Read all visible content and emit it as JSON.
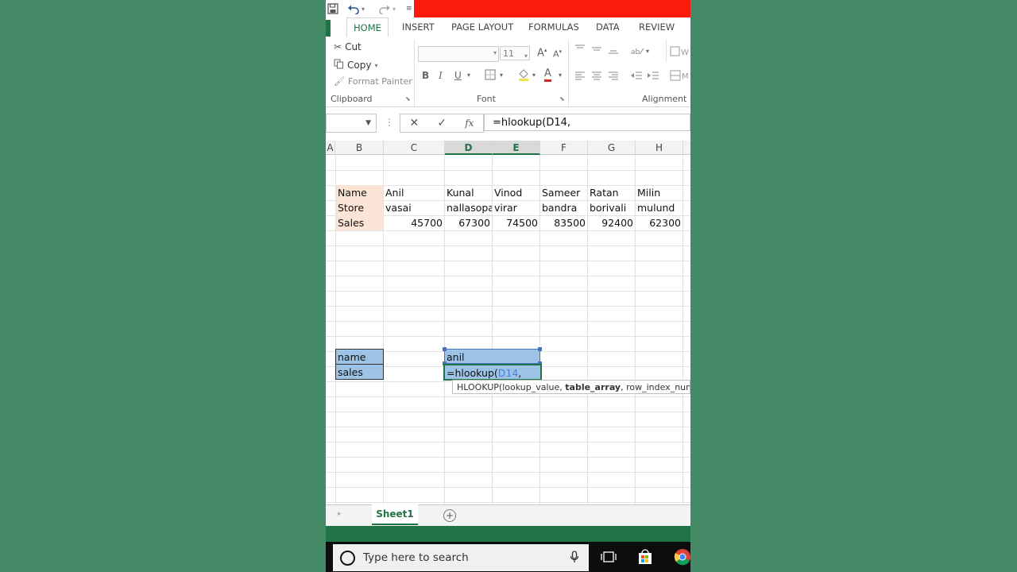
{
  "ribbon_tabs": [
    "HOME",
    "INSERT",
    "PAGE LAYOUT",
    "FORMULAS",
    "DATA",
    "REVIEW"
  ],
  "clipboard": {
    "cut": "Cut",
    "copy": "Copy",
    "format_painter": "Format Painter",
    "label": "Clipboard"
  },
  "font_group": {
    "size": "11",
    "bold": "B",
    "italic": "I",
    "underline": "U",
    "label": "Font",
    "grow": "A",
    "shrink": "A"
  },
  "alignment_group": {
    "label": "Alignment"
  },
  "formula_bar": {
    "fx": "fx",
    "content": "=hlookup(D14,"
  },
  "columns": [
    "A",
    "B",
    "C",
    "D",
    "E",
    "F",
    "G",
    "H"
  ],
  "table": {
    "row1": [
      "Name",
      "Anil",
      "Kunal",
      "Vinod",
      "Sameer",
      "Ratan",
      "Milin"
    ],
    "row2": [
      "Store",
      "vasai",
      "nallasopa",
      "virar",
      "bandra",
      "borivali",
      "mulund"
    ],
    "row3": [
      "Sales",
      "45700",
      "67300",
      "74500",
      "83500",
      "92400",
      "62300"
    ]
  },
  "lookup": {
    "name_label": "name",
    "sales_label": "sales",
    "name_value": "anil",
    "formula_prefix": "=hlookup(",
    "formula_ref": "D14",
    "formula_suffix": ","
  },
  "tooltip": {
    "func": "HLOOKUP(",
    "arg1": "lookup_value, ",
    "arg2_bold": "table_array",
    "rest": ", row_index_num, [ran"
  },
  "sheet_tab": "Sheet1",
  "taskbar": {
    "search_placeholder": "Type here to search"
  },
  "colors": {
    "excel_green": "#217346",
    "ref_blue": "#9dc3e6",
    "peach": "#fce4d6",
    "title_red": "#fb1a0c"
  }
}
